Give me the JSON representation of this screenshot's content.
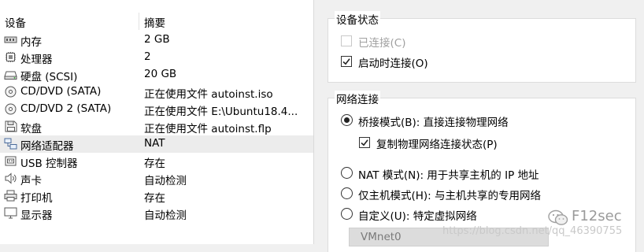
{
  "table": {
    "headers": {
      "device": "设备",
      "summary": "摘要"
    },
    "rows": [
      {
        "icon": "memory-icon",
        "name": "内存",
        "summary": "2 GB"
      },
      {
        "icon": "processor-icon",
        "name": "处理器",
        "summary": "2"
      },
      {
        "icon": "hard-disk-icon",
        "name": "硬盘 (SCSI)",
        "summary": "20 GB"
      },
      {
        "icon": "cd-dvd-icon",
        "name": "CD/DVD (SATA)",
        "summary": "正在使用文件 autoinst.iso"
      },
      {
        "icon": "cd-dvd-icon",
        "name": "CD/DVD 2 (SATA)",
        "summary": "正在使用文件 E:\\Ubuntu18.4..."
      },
      {
        "icon": "floppy-icon",
        "name": "软盘",
        "summary": "正在使用文件 autoinst.flp"
      },
      {
        "icon": "network-adapter-icon",
        "name": "网络适配器",
        "summary": "NAT"
      },
      {
        "icon": "usb-icon",
        "name": "USB 控制器",
        "summary": "存在"
      },
      {
        "icon": "sound-icon",
        "name": "声卡",
        "summary": "自动检测"
      },
      {
        "icon": "printer-icon",
        "name": "打印机",
        "summary": "存在"
      },
      {
        "icon": "display-icon",
        "name": "显示器",
        "summary": "自动检测"
      }
    ],
    "selected_index": 6
  },
  "device_status": {
    "title": "设备状态",
    "connected": {
      "label": "已连接(C)",
      "checked": false,
      "enabled": false
    },
    "connect_at_power_on": {
      "label": "启动时连接(O)",
      "checked": true,
      "enabled": true
    }
  },
  "network_connection": {
    "title": "网络连接",
    "bridged": {
      "label": "桥接模式(B): 直接连接物理网络",
      "selected": true
    },
    "replicate_state": {
      "label": "复制物理网络连接状态(P)",
      "checked": true
    },
    "nat": {
      "label": "NAT 模式(N): 用于共享主机的 IP 地址",
      "selected": false
    },
    "host_only": {
      "label": "仅主机模式(H): 与主机共享的专用网络",
      "selected": false
    },
    "custom": {
      "label": "自定义(U): 特定虚拟网络",
      "selected": false
    },
    "vmnet_value": "VMnet0"
  },
  "watermark": {
    "url": "https://blog.csdn.net/qq_46390755",
    "brand": "F12sec"
  }
}
